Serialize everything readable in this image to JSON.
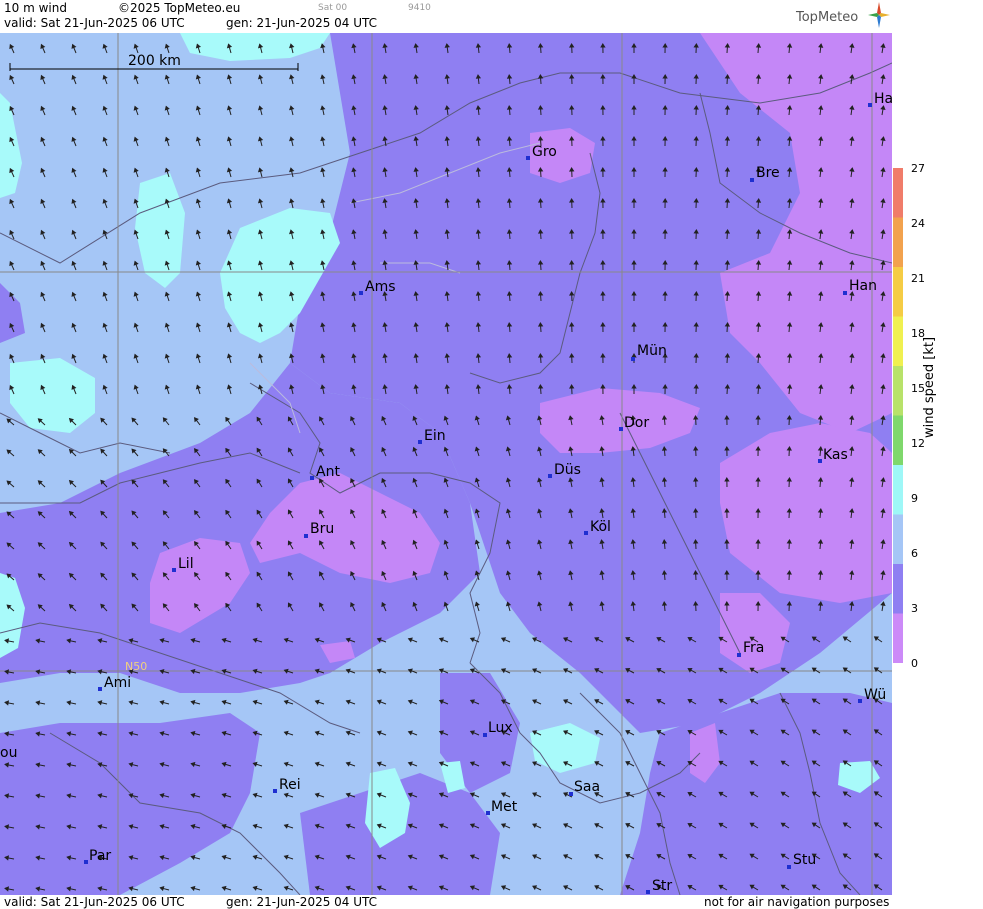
{
  "header": {
    "field": "10 m wind",
    "copyright": "©2025 TopMeteo.eu",
    "run_small": "Sat 00",
    "code_small": "9410",
    "valid": "valid:  Sat  21-Jun-2025  06 UTC",
    "gen": "gen: 21-Jun-2025 04 UTC",
    "brand": "TopMeteo"
  },
  "footer": {
    "valid": "valid:  Sat  21-Jun-2025  06 UTC",
    "gen": "gen: 21-Jun-2025 04 UTC",
    "disclaimer": "not for air navigation purposes"
  },
  "map": {
    "scale_label": "200 km",
    "lat_label": "N50",
    "cities": [
      {
        "name": "Gro"
      },
      {
        "name": "Bre"
      },
      {
        "name": "Ha"
      },
      {
        "name": "Ams"
      },
      {
        "name": "Han"
      },
      {
        "name": "Mün"
      },
      {
        "name": "Ein"
      },
      {
        "name": "Dor"
      },
      {
        "name": "Ant"
      },
      {
        "name": "Düs"
      },
      {
        "name": "Kas"
      },
      {
        "name": "Bru"
      },
      {
        "name": "Köl"
      },
      {
        "name": "Lil"
      },
      {
        "name": "Fra"
      },
      {
        "name": "Ami"
      },
      {
        "name": "Wü"
      },
      {
        "name": "Lux"
      },
      {
        "name": "ou"
      },
      {
        "name": "Rei"
      },
      {
        "name": "Saa"
      },
      {
        "name": "Met"
      },
      {
        "name": "Par"
      },
      {
        "name": "Stu"
      },
      {
        "name": "Str"
      }
    ]
  },
  "legend": {
    "title": "wind speed [kt]",
    "ticks": [
      "27",
      "24",
      "21",
      "18",
      "15",
      "12",
      "9",
      "6",
      "3",
      "0"
    ],
    "colors": [
      "#f07c6a",
      "#f2a24e",
      "#f5cc45",
      "#f0f050",
      "#b8e26a",
      "#7fd86c",
      "#9ef7f7",
      "#a5c6f6",
      "#8f7ff2",
      "#cc8af8"
    ]
  },
  "colors": {
    "light_blue": "#a5c6f6",
    "cyan": "#a8fafa",
    "violet": "#8f7ff2",
    "lilac": "#c487f7"
  }
}
